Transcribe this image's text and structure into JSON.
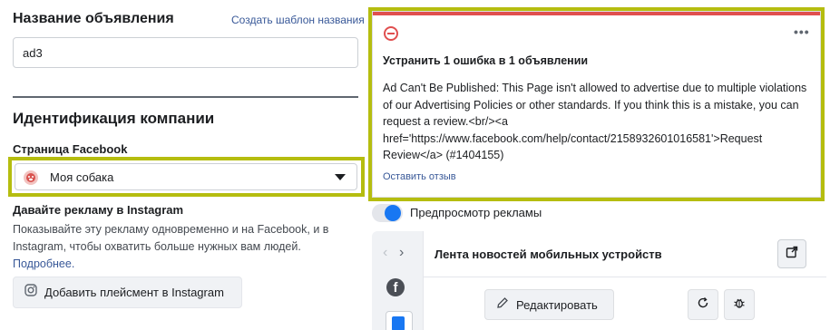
{
  "ad_name": {
    "label": "Название объявления",
    "template_link": "Создать шаблон названия",
    "value": "ad3"
  },
  "identity": {
    "section_title": "Идентификация компании",
    "facebook_page_label": "Страница Facebook",
    "selected_page": "Моя собака"
  },
  "instagram": {
    "title": "Давайте рекламу в Instagram",
    "description": "Показывайте эту рекламу одновременно и на Facebook, и в Instagram, чтобы охватить больше нужных вам людей.",
    "more_link": "Подробнее.",
    "add_button": "Добавить плейсмент в Instagram"
  },
  "error": {
    "title": "Устранить 1 ошибка в 1 объявлении",
    "message": "Ad Can't Be Published: This Page isn't allowed to advertise due to multiple violations of our Advertising Policies or other standards. If you think this is a mistake, you can request a review.<br/><a href='https://www.facebook.com/help/contact/2158932601016581'>Request Review</a> (#1404155)",
    "feedback_link": "Оставить отзыв",
    "more_menu": "•••",
    "accent_color": "#e04f4f"
  },
  "preview": {
    "toggle_label": "Предпросмотр рекламы",
    "toggle_on": true,
    "placement_title": "Лента новостей мобильных устройств",
    "edit_button": "Редактировать",
    "nav_prev": "‹",
    "nav_next": "›",
    "facebook_glyph": "f"
  },
  "colors": {
    "highlight": "#b5bd0f",
    "link": "#385898",
    "toggle_active": "#1877f2"
  }
}
